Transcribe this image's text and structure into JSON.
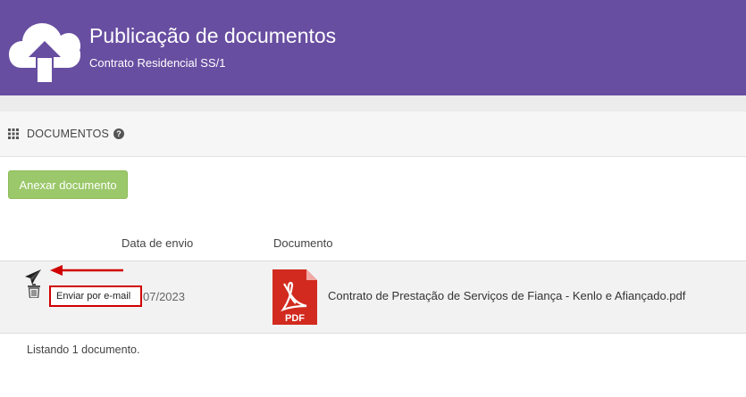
{
  "header": {
    "title": "Publicação de documentos",
    "subtitle": "Contrato Residencial SS/1",
    "icon": "cloud-upload-icon",
    "bg_color": "#684ea1"
  },
  "section": {
    "title": "DOCUMENTOS",
    "icon": "grid-icon",
    "help_icon": "question-circle-icon"
  },
  "actions": {
    "attach_label": "Anexar documento",
    "attach_color": "#9bc86a"
  },
  "table": {
    "columns": [
      "Data de envio",
      "Documento"
    ],
    "rows": [
      {
        "date": "07/2023",
        "document": "Contrato de Prestação de Serviços de Fiança - Kenlo e Afiançado.pdf",
        "file_icon": "pdf-icon",
        "file_label": "PDF",
        "actions": [
          "send-icon",
          "trash-icon"
        ]
      }
    ]
  },
  "tooltip": {
    "text": "Enviar por e-mail",
    "highlight_color": "#d00000"
  },
  "footer": {
    "status": "Listando 1 documento."
  }
}
